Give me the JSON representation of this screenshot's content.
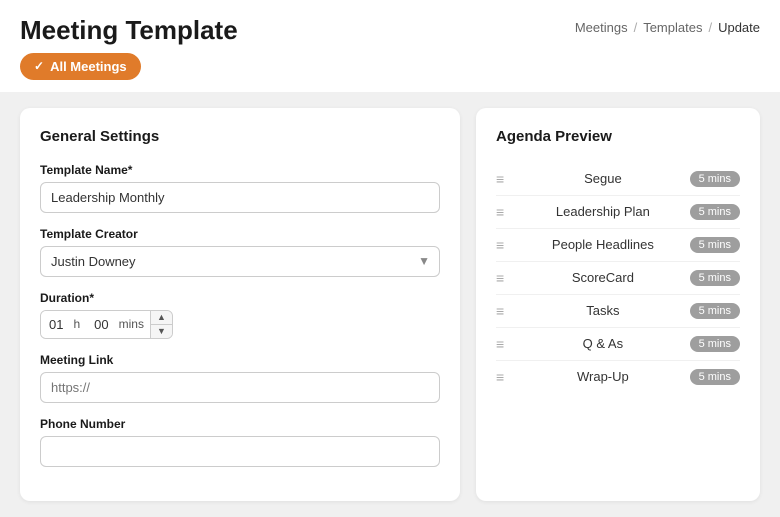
{
  "page": {
    "title": "Meeting Template",
    "breadcrumb": {
      "items": [
        "Meetings",
        "Templates",
        "Update"
      ],
      "separators": [
        "/",
        "/"
      ]
    },
    "all_meetings_btn": "All Meetings"
  },
  "left_panel": {
    "title": "General Settings",
    "template_name_label": "Template Name*",
    "template_name_value": "Leadership Monthly",
    "template_creator_label": "Template Creator",
    "template_creator_value": "Justin Downey",
    "duration_label": "Duration*",
    "duration_hours": "01",
    "duration_hours_label": "h",
    "duration_mins": "00",
    "duration_mins_label": "mins",
    "meeting_link_label": "Meeting Link",
    "meeting_link_placeholder": "https://",
    "phone_label": "Phone Number",
    "phone_placeholder": ""
  },
  "right_panel": {
    "title": "Agenda Preview",
    "items": [
      {
        "name": "Segue",
        "duration": "5 mins"
      },
      {
        "name": "Leadership Plan",
        "duration": "5 mins"
      },
      {
        "name": "People Headlines",
        "duration": "5 mins"
      },
      {
        "name": "ScoreCard",
        "duration": "5 mins"
      },
      {
        "name": "Tasks",
        "duration": "5 mins"
      },
      {
        "name": "Q & As",
        "duration": "5 mins"
      },
      {
        "name": "Wrap-Up",
        "duration": "5 mins"
      }
    ]
  }
}
